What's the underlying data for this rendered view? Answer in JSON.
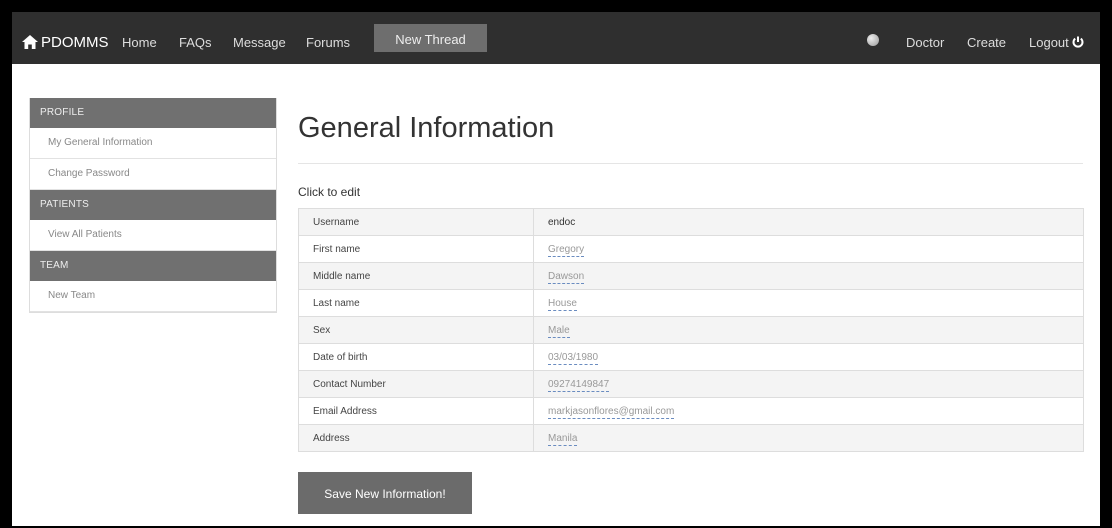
{
  "navbar": {
    "brand": "PDOMMS",
    "home": "Home",
    "faqs": "FAQs",
    "message": "Message",
    "forums": "Forums",
    "new_thread": "New Thread",
    "doctor": "Doctor",
    "create": "Create",
    "logout": "Logout"
  },
  "sidebar": {
    "profile_header": "PROFILE",
    "general_info": "My General Information",
    "change_password": "Change Password",
    "patients_header": "PATIENTS",
    "view_all_patients": "View All Patients",
    "team_header": "TEAM",
    "new_team": "New Team"
  },
  "main": {
    "title": "General Information",
    "click_to_edit": "Click to edit",
    "rows": [
      {
        "label": "Username",
        "value": "endoc"
      },
      {
        "label": "First name",
        "value": "Gregory"
      },
      {
        "label": "Middle name",
        "value": "Dawson"
      },
      {
        "label": "Last name",
        "value": "House"
      },
      {
        "label": "Sex",
        "value": "Male"
      },
      {
        "label": "Date of birth",
        "value": "03/03/1980"
      },
      {
        "label": "Contact Number",
        "value": "09274149847"
      },
      {
        "label": "Email Address",
        "value": "markjasonflores@gmail.com"
      },
      {
        "label": "Address",
        "value": "Manila"
      }
    ],
    "save_button": "Save New Information!"
  },
  "colors": {
    "navbar_bg": "#2f2f2f",
    "sidebar_header_bg": "#707070",
    "button_bg": "#6b6b6b"
  },
  "icons": {
    "brand": "home-icon",
    "globe": "globe-icon",
    "logout": "power-icon"
  }
}
